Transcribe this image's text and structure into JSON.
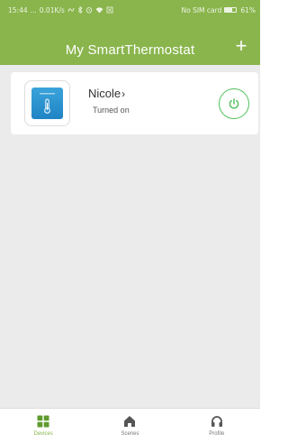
{
  "status_bar": {
    "time": "15:44",
    "dots": "...",
    "speed": "0.01K/s",
    "carrier": "No SIM card",
    "battery": "61%",
    "battery_level": 0.61
  },
  "header": {
    "title": "My SmartThermostat",
    "add_label": "+"
  },
  "device": {
    "name": "Nicole",
    "chevron": "›",
    "status": "Turned on"
  },
  "bottom_nav": {
    "items": [
      {
        "label": "Devices",
        "icon": "grid-icon",
        "active": true
      },
      {
        "label": "Scenes",
        "icon": "home-icon",
        "active": false
      },
      {
        "label": "Profile",
        "icon": "headphones-icon",
        "active": false
      }
    ]
  },
  "colors": {
    "header_green": "#8ab54d",
    "power_green": "#4fbf5a",
    "device_blue": "#2a93d1",
    "background": "#ebebeb"
  }
}
